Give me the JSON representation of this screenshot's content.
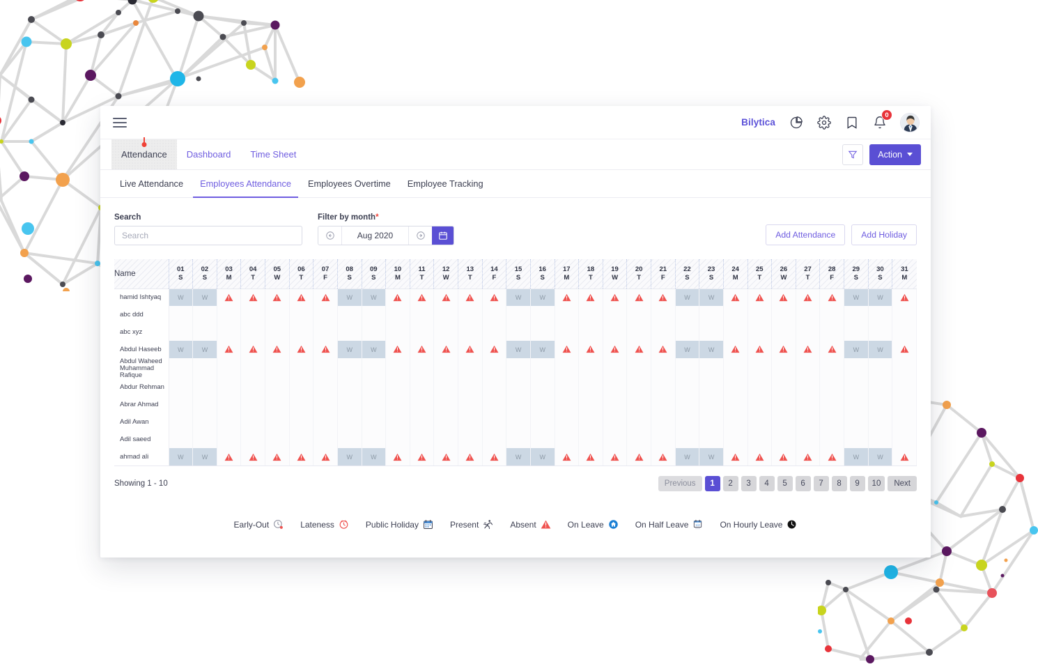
{
  "topbar": {
    "menu_icon": "hamburger-icon",
    "brand": "Bilytica",
    "icons": [
      "pie-chart-icon",
      "gear-icon",
      "bookmark-icon",
      "bell-icon"
    ],
    "notification_count": "0",
    "avatar": "user-avatar"
  },
  "modules": [
    {
      "label": "Attendance",
      "active": true
    },
    {
      "label": "Dashboard",
      "active": false
    },
    {
      "label": "Time Sheet",
      "active": false
    }
  ],
  "module_actions": {
    "filter_icon": "funnel-icon",
    "action_label": "Action",
    "action_caret": "chevron-down-icon"
  },
  "subtabs": [
    {
      "label": "Live Attendance",
      "active": false
    },
    {
      "label": "Employees Attendance",
      "active": true
    },
    {
      "label": "Employees Overtime",
      "active": false
    },
    {
      "label": "Employee Tracking",
      "active": false
    }
  ],
  "filters": {
    "search_label": "Search",
    "search_placeholder": "Search",
    "search_value": "",
    "month_label": "Filter by month",
    "month_required": "*",
    "month_value": "Aug 2020",
    "prev_icon": "arrow-left-circle-icon",
    "next_icon": "arrow-right-circle-icon",
    "calendar_icon": "calendar-icon",
    "add_attendance": "Add Attendance",
    "add_holiday": "Add Holiday"
  },
  "table": {
    "name_header": "Name",
    "days": [
      {
        "d": "01",
        "w": "S"
      },
      {
        "d": "02",
        "w": "S"
      },
      {
        "d": "03",
        "w": "M"
      },
      {
        "d": "04",
        "w": "T"
      },
      {
        "d": "05",
        "w": "W"
      },
      {
        "d": "06",
        "w": "T"
      },
      {
        "d": "07",
        "w": "F"
      },
      {
        "d": "08",
        "w": "S"
      },
      {
        "d": "09",
        "w": "S"
      },
      {
        "d": "10",
        "w": "M"
      },
      {
        "d": "11",
        "w": "T"
      },
      {
        "d": "12",
        "w": "W"
      },
      {
        "d": "13",
        "w": "T"
      },
      {
        "d": "14",
        "w": "F"
      },
      {
        "d": "15",
        "w": "S"
      },
      {
        "d": "16",
        "w": "S"
      },
      {
        "d": "17",
        "w": "M"
      },
      {
        "d": "18",
        "w": "T"
      },
      {
        "d": "19",
        "w": "W"
      },
      {
        "d": "20",
        "w": "T"
      },
      {
        "d": "21",
        "w": "F"
      },
      {
        "d": "22",
        "w": "S"
      },
      {
        "d": "23",
        "w": "S"
      },
      {
        "d": "24",
        "w": "M"
      },
      {
        "d": "25",
        "w": "T"
      },
      {
        "d": "26",
        "w": "W"
      },
      {
        "d": "27",
        "w": "T"
      },
      {
        "d": "28",
        "w": "F"
      },
      {
        "d": "29",
        "w": "S"
      },
      {
        "d": "30",
        "w": "S"
      },
      {
        "d": "31",
        "w": "M"
      }
    ],
    "weekend_label": "W",
    "rows": [
      {
        "name": "hamid Ishtyaq",
        "multiline": false,
        "filled": true
      },
      {
        "name": "abc ddd",
        "multiline": false,
        "filled": false
      },
      {
        "name": "abc xyz",
        "multiline": false,
        "filled": false
      },
      {
        "name": "Abdul Haseeb",
        "multiline": false,
        "filled": true
      },
      {
        "name": "Abdul Waheed Muhammad Rafique",
        "multiline": true,
        "filled": false
      },
      {
        "name": "Abdur Rehman",
        "multiline": false,
        "filled": false
      },
      {
        "name": "Abrar Ahmad",
        "multiline": false,
        "filled": false
      },
      {
        "name": "Adil Awan",
        "multiline": false,
        "filled": false
      },
      {
        "name": "Adil saeed",
        "multiline": false,
        "filled": false
      },
      {
        "name": "ahmad ali",
        "multiline": false,
        "filled": true
      }
    ]
  },
  "footer": {
    "showing": "Showing 1 - 10",
    "previous": "Previous",
    "next": "Next",
    "pages": [
      "1",
      "2",
      "3",
      "4",
      "5",
      "6",
      "7",
      "8",
      "9",
      "10"
    ],
    "current_page": "1"
  },
  "legend": [
    {
      "label": "Early-Out",
      "icon": "early-out-clock-icon"
    },
    {
      "label": "Lateness",
      "icon": "lateness-clock-icon"
    },
    {
      "label": "Public Holiday",
      "icon": "public-holiday-calendar-icon"
    },
    {
      "label": "Present",
      "icon": "running-person-icon"
    },
    {
      "label": "Absent",
      "icon": "warning-triangle-icon"
    },
    {
      "label": "On Leave",
      "icon": "home-circle-icon"
    },
    {
      "label": "On Half Leave",
      "icon": "half-day-calendar-icon"
    },
    {
      "label": "On Hourly Leave",
      "icon": "black-clock-icon"
    }
  ],
  "colors": {
    "accent": "#5a4fd4",
    "link": "#6f5de0",
    "absent": "#ef4b4b",
    "weekend_cell": "#ccd8e4",
    "badge": "#e8333a",
    "marker": "#ef4136"
  },
  "decoration": {
    "top_left": "network-graph-decoration",
    "bottom_right": "network-graph-decoration"
  }
}
